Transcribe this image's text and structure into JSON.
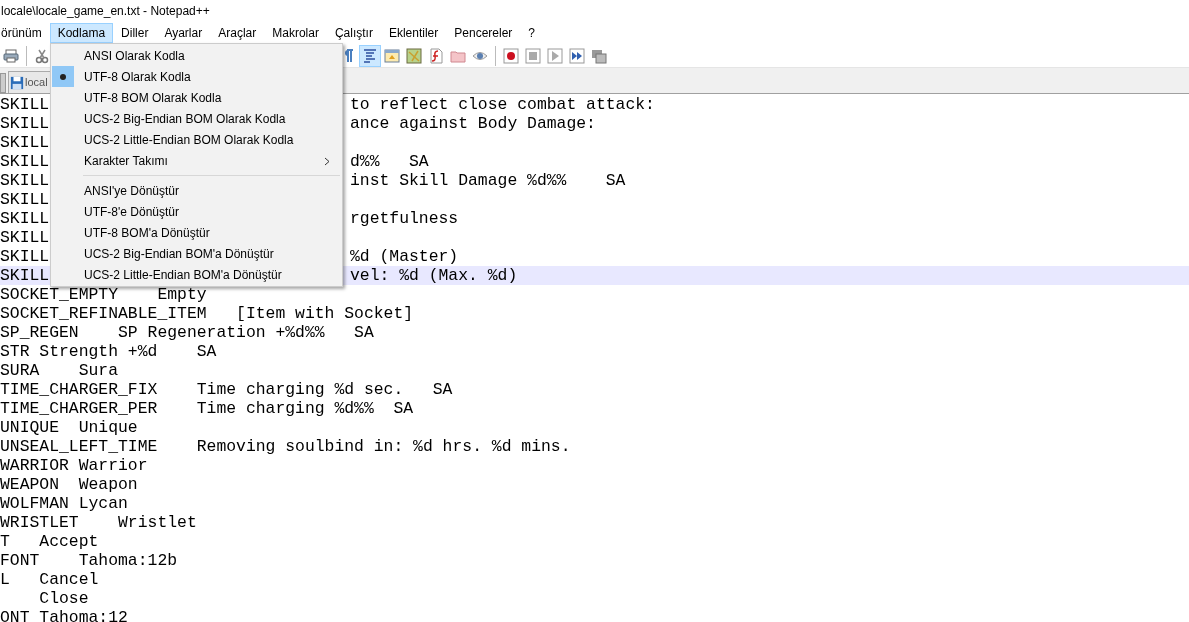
{
  "window": {
    "title": "locale\\locale_game_en.txt - Notepad++"
  },
  "menubar": [
    {
      "label": "örünüm",
      "selected": false
    },
    {
      "label": "Kodlama",
      "selected": true
    },
    {
      "label": "Diller",
      "selected": false
    },
    {
      "label": "Ayarlar",
      "selected": false
    },
    {
      "label": "Araçlar",
      "selected": false
    },
    {
      "label": "Makrolar",
      "selected": false
    },
    {
      "label": "Çalıştır",
      "selected": false
    },
    {
      "label": "Eklentiler",
      "selected": false
    },
    {
      "label": "Pencereler",
      "selected": false
    },
    {
      "label": "?",
      "selected": false
    }
  ],
  "toolbar": {
    "left": [
      {
        "kind": "print",
        "pressed": false
      },
      {
        "kind": "sep"
      },
      {
        "kind": "cut",
        "pressed": false
      }
    ],
    "right": [
      {
        "kind": "pilcrow",
        "pressed": false
      },
      {
        "kind": "wrap",
        "pressed": true
      },
      {
        "kind": "panel",
        "pressed": false
      },
      {
        "kind": "map",
        "pressed": false
      },
      {
        "kind": "doc",
        "pressed": false
      },
      {
        "kind": "folder",
        "pressed": false
      },
      {
        "kind": "eye",
        "pressed": false
      },
      {
        "kind": "sep"
      },
      {
        "kind": "record",
        "pressed": false
      },
      {
        "kind": "stop",
        "pressed": false
      },
      {
        "kind": "play",
        "pressed": false
      },
      {
        "kind": "fastforward",
        "pressed": false
      },
      {
        "kind": "macrosave",
        "pressed": false
      }
    ]
  },
  "tabs": [
    {
      "label": "local",
      "selected": true
    }
  ],
  "editor": {
    "covered_lines": [
      {
        "left": "SKILL",
        "right": "to reflect close combat attack:",
        "current": false
      },
      {
        "left": "SKILL",
        "right": "ance against Body Damage:",
        "current": false
      },
      {
        "left": "SKILL",
        "current": false
      },
      {
        "left": "SKILL",
        "right": "d%%   SA",
        "current": false
      },
      {
        "left": "SKILL",
        "right": "inst Skill Damage %d%%    SA",
        "current": false
      },
      {
        "left": "SKILL",
        "current": false
      },
      {
        "left": "SKILL",
        "right": "rgetfulness",
        "current": false
      },
      {
        "left": "SKILL",
        "current": false
      },
      {
        "left": "SKILL",
        "right": "%d (Master)",
        "current": false
      },
      {
        "left": "SKILL",
        "right": "vel: %d (Max. %d)",
        "current": true
      }
    ],
    "lines": [
      "SOCKET_EMPTY    Empty",
      "SOCKET_REFINABLE_ITEM   [Item with Socket]",
      "SP_REGEN    SP Regeneration +%d%%   SA",
      "STR Strength +%d    SA",
      "SURA    Sura",
      "TIME_CHARGER_FIX    Time charging %d sec.   SA",
      "TIME_CHARGER_PER    Time charging %d%%  SA",
      "UNIQUE  Unique",
      "UNSEAL_LEFT_TIME    Removing soulbind in: %d hrs. %d mins.",
      "WARRIOR Warrior",
      "WEAPON  Weapon",
      "WOLFMAN Lycan",
      "WRISTLET    Wristlet",
      "T   Accept",
      "FONT    Tahoma:12b",
      "L   Cancel",
      "    Close",
      "ONT Tahoma:12"
    ]
  },
  "menu": [
    {
      "kind": "item",
      "label": "ANSI Olarak Kodla",
      "selected": false,
      "submenu": false
    },
    {
      "kind": "item",
      "label": "UTF-8 Olarak Kodla",
      "selected": true,
      "submenu": false
    },
    {
      "kind": "item",
      "label": "UTF-8 BOM Olarak Kodla",
      "selected": false,
      "submenu": false
    },
    {
      "kind": "item",
      "label": "UCS-2 Big-Endian BOM Olarak Kodla",
      "selected": false,
      "submenu": false
    },
    {
      "kind": "item",
      "label": "UCS-2 Little-Endian BOM Olarak Kodla",
      "selected": false,
      "submenu": false
    },
    {
      "kind": "item",
      "label": "Karakter Takımı",
      "selected": false,
      "submenu": true
    },
    {
      "kind": "separator"
    },
    {
      "kind": "item",
      "label": "ANSI'ye Dönüştür",
      "selected": false,
      "submenu": false
    },
    {
      "kind": "item",
      "label": "UTF-8'e Dönüştür",
      "selected": false,
      "submenu": false
    },
    {
      "kind": "item",
      "label": "UTF-8 BOM'a Dönüştür",
      "selected": false,
      "submenu": false
    },
    {
      "kind": "item",
      "label": "UCS-2 Big-Endian BOM'a Dönüştür",
      "selected": false,
      "submenu": false
    },
    {
      "kind": "item",
      "label": "UCS-2 Little-Endian BOM'a Dönüştür",
      "selected": false,
      "submenu": false
    }
  ]
}
